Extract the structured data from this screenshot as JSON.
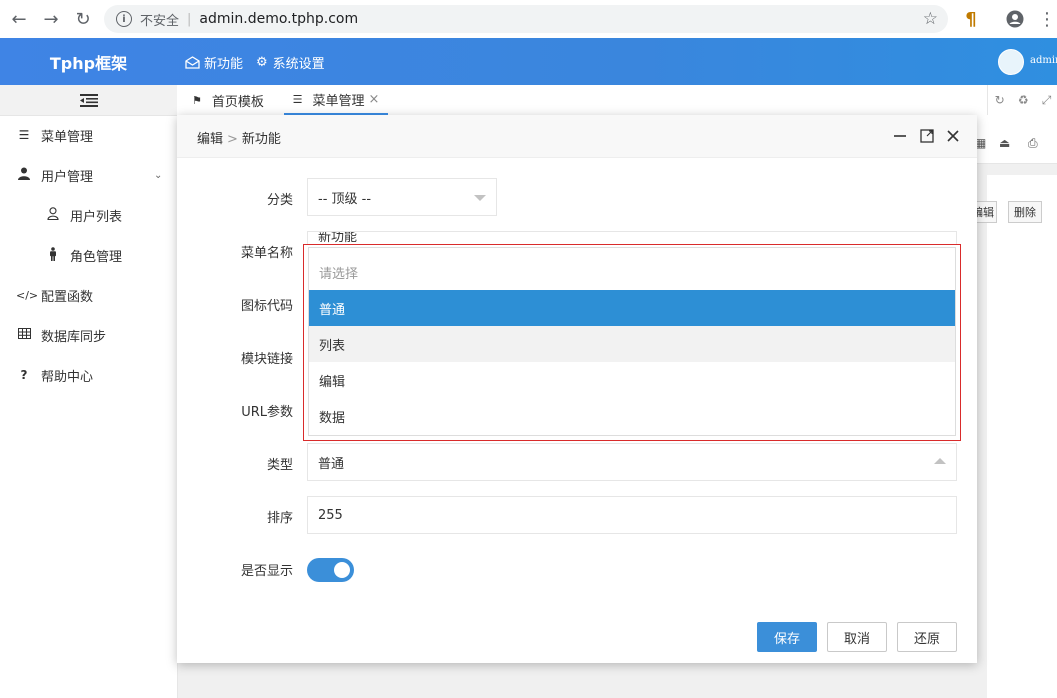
{
  "browser": {
    "insecure_label": "不安全",
    "url": "admin.demo.tphp.com"
  },
  "app": {
    "brand": "Tphp框架",
    "topnav": [
      {
        "label": "新功能",
        "icon": "envelope-open-icon"
      },
      {
        "label": "系统设置",
        "icon": "gear-icon"
      }
    ],
    "user_name": "admin"
  },
  "sidebar": {
    "items": [
      {
        "label": "菜单管理",
        "icon": "menu-lines-icon"
      },
      {
        "label": "用户管理",
        "icon": "user-icon"
      },
      {
        "label": "用户列表",
        "icon": "user-outline-icon"
      },
      {
        "label": "角色管理",
        "icon": "person-standing-icon"
      },
      {
        "label": "配置函数",
        "icon": "code-icon"
      },
      {
        "label": "数据库同步",
        "icon": "table-icon"
      },
      {
        "label": "帮助中心",
        "icon": "question-icon"
      }
    ]
  },
  "tabs": [
    {
      "label": "首页模板",
      "icon": "flag-icon"
    },
    {
      "label": "菜单管理",
      "icon": "menu-lines-icon",
      "close": "×"
    }
  ],
  "background": {
    "edit_btn": "编辑",
    "delete_btn": "删除"
  },
  "modal": {
    "crumb_parent": "编辑",
    "crumb_sep": ">",
    "crumb_current": "新功能",
    "fields": {
      "category_label": "分类",
      "category_value": "-- 顶级 --",
      "menu_name_label": "菜单名称",
      "menu_name_value": "新功能",
      "icon_code_label": "图标代码",
      "module_link_label": "模块链接",
      "url_param_label": "URL参数",
      "type_label": "类型",
      "type_value": "普通",
      "sort_label": "排序",
      "sort_value": "255",
      "show_label": "是否显示"
    },
    "buttons": {
      "save": "保存",
      "cancel": "取消",
      "reset": "还原"
    },
    "show_enabled": true
  },
  "dropdown": {
    "placeholder": "请选择",
    "options": [
      "普通",
      "列表",
      "编辑",
      "数据"
    ],
    "selected": "普通",
    "hovered": "列表"
  }
}
